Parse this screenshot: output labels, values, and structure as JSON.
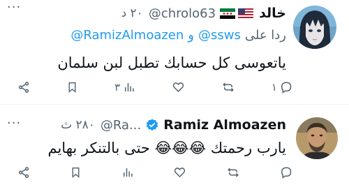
{
  "tweets": [
    {
      "display_name": "خالد",
      "handle": "@chrolo63",
      "time": "٢٠ د",
      "flags": [
        "us-flag",
        "syria-revolution-flag"
      ],
      "reply_word": "ردا على",
      "reply_to": [
        "@ssws",
        "@RamizAlmoazen",
        "و"
      ],
      "text": "ياتعوسى كل حسابك تطبل لبن سلمان",
      "actions": {
        "share_label": "",
        "bookmark_label": "",
        "views": "٣",
        "likes": "",
        "retweets": "",
        "replies": "١"
      }
    },
    {
      "display_name": "Ramiz Almoazen",
      "handle": "@Ra...",
      "time": "٢٨٠ ث",
      "verified": true,
      "text": "يارب رحمتك 😂😂😂 حتى بالتنكر بهايم",
      "actions": {
        "views": "",
        "likes": "",
        "retweets": "",
        "replies": ""
      }
    }
  ],
  "colors": {
    "accent": "#1d9bf0",
    "secondary_text": "#536471",
    "primary_text": "#0f1419",
    "divider": "#eff3f4"
  }
}
